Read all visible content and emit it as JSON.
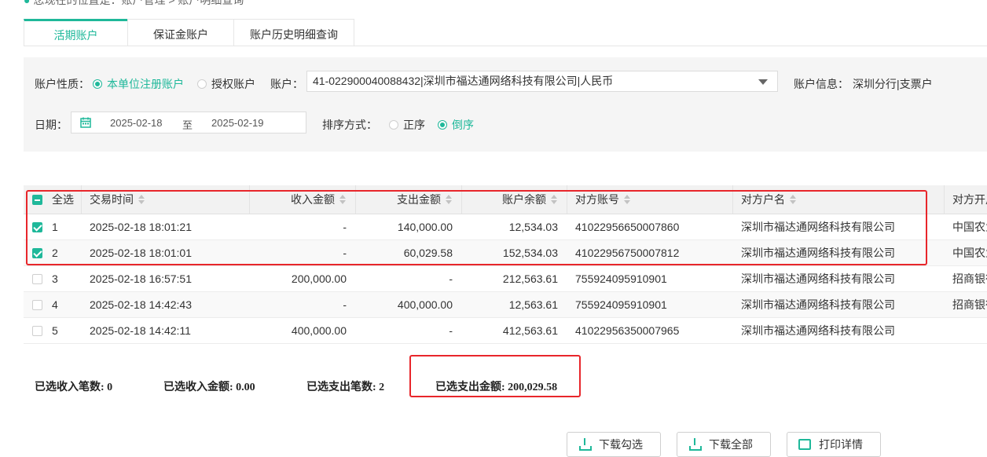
{
  "breadcrumb": "您现在的位置是：账户管理 > 账户明细查询",
  "tabs": [
    {
      "label": "活期账户",
      "active": true
    },
    {
      "label": "保证金账户",
      "active": false
    },
    {
      "label": "账户历史明细查询",
      "active": false
    }
  ],
  "filter": {
    "account_type_label": "账户性质：",
    "account_type_options": [
      {
        "label": "本单位注册账户",
        "selected": true
      },
      {
        "label": "授权账户",
        "selected": false
      }
    ],
    "account_label": "账户：",
    "account_value": "41-022900040088432|深圳市福达通网络科技有限公司|人民币",
    "account_info_label": "账户信息：",
    "account_info_value": "深圳分行|支票户",
    "date_label": "日期：",
    "date_from": "2025-02-18",
    "date_sep": "至",
    "date_to": "2025-02-19",
    "sort_label": "排序方式：",
    "sort_options": [
      {
        "label": "正序",
        "selected": false
      },
      {
        "label": "倒序",
        "selected": true
      }
    ]
  },
  "table": {
    "headers": {
      "select_all": "全选",
      "time": "交易时间",
      "income": "收入金额",
      "expense": "支出金额",
      "balance": "账户余额",
      "counter_account": "对方账号",
      "counter_name": "对方户名",
      "counter_bank": "对方开户行"
    },
    "rows": [
      {
        "idx": "1",
        "checked": true,
        "time": "2025-02-18 18:01:21",
        "income": "-",
        "expense": "140,000.00",
        "balance": "12,534.03",
        "counter_account": "41022956650007860",
        "counter_name": "深圳市福达通网络科技有限公司",
        "counter_bank": "中国农业银行"
      },
      {
        "idx": "2",
        "checked": true,
        "time": "2025-02-18 18:01:01",
        "income": "-",
        "expense": "60,029.58",
        "balance": "152,534.03",
        "counter_account": "41022956750007812",
        "counter_name": "深圳市福达通网络科技有限公司",
        "counter_bank": "中国农业银行"
      },
      {
        "idx": "3",
        "checked": false,
        "time": "2025-02-18 16:57:51",
        "income": "200,000.00",
        "expense": "-",
        "balance": "212,563.61",
        "counter_account": "755924095910901",
        "counter_name": "深圳市福达通网络科技有限公司",
        "counter_bank": "招商银行"
      },
      {
        "idx": "4",
        "checked": false,
        "time": "2025-02-18 14:42:43",
        "income": "-",
        "expense": "400,000.00",
        "balance": "12,563.61",
        "counter_account": "755924095910901",
        "counter_name": "深圳市福达通网络科技有限公司",
        "counter_bank": "招商银行"
      },
      {
        "idx": "5",
        "checked": false,
        "time": "2025-02-18 14:42:11",
        "income": "400,000.00",
        "expense": "-",
        "balance": "412,563.61",
        "counter_account": "41022956350007965",
        "counter_name": "深圳市福达通网络科技有限公司",
        "counter_bank": ""
      }
    ]
  },
  "summary": {
    "income_count": "已选收入笔数: 0",
    "income_amount": "已选收入金额: 0.00",
    "expense_count": "已选支出笔数: 2",
    "expense_amount": "已选支出金额: 200,029.58"
  },
  "buttons": {
    "download_selected": "下载勾选",
    "download_all": "下载全部",
    "print_detail": "打印详情"
  },
  "colors": {
    "accent": "#1fb89a",
    "highlight_box": "#e8262b"
  }
}
